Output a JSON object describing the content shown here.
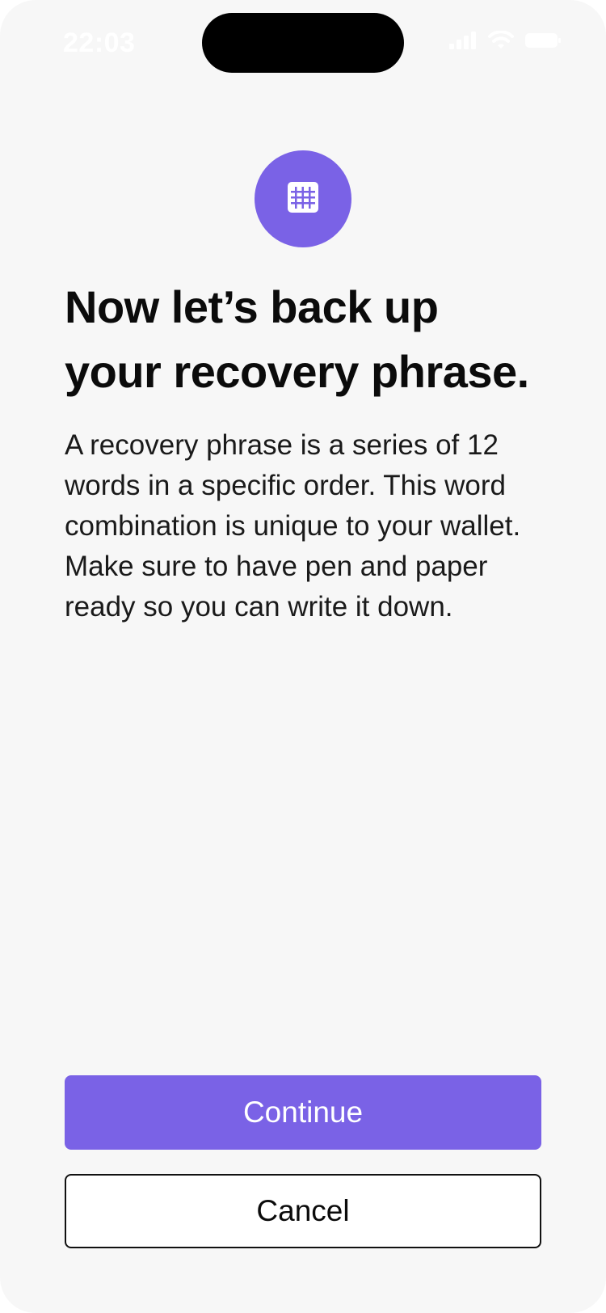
{
  "status_bar": {
    "time": "22:03",
    "icons": [
      "signal-icon",
      "wifi-icon",
      "battery-icon"
    ]
  },
  "hero": {
    "icon": "grid-icon",
    "accent_color": "#7a62e6"
  },
  "content": {
    "title_line1": "Now let’s back up",
    "title_line2": "your recovery phrase.",
    "body": "A recovery phrase is a series of 12 words in a specific order. This word combination is unique to your wallet. Make sure to have pen and paper ready so you can write it down."
  },
  "actions": {
    "continue_label": "Continue",
    "cancel_label": "Cancel"
  }
}
